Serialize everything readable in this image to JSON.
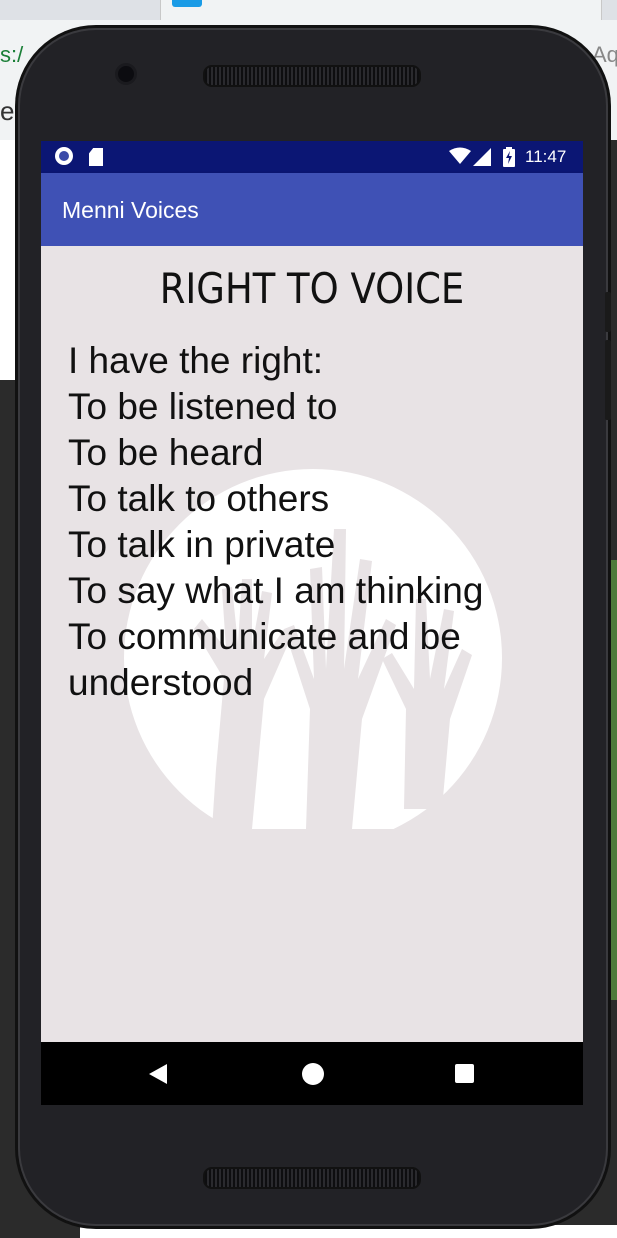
{
  "browser": {
    "url_fragment_left": "s:/",
    "url_fragment_left2": "e,",
    "url_fragment_right": "Aq"
  },
  "status_bar": {
    "time": "11:47",
    "icons": [
      "notification-circle-icon",
      "sd-card-icon",
      "wifi-icon",
      "cell-signal-icon",
      "battery-charging-icon"
    ]
  },
  "app_bar": {
    "title": "Menni Voices"
  },
  "content": {
    "heading": "RIGHT TO VOICE",
    "lines": [
      "I have the right:",
      "To be listened to",
      "To be heard",
      "To talk to others",
      "To talk in private",
      "To say what I am thinking",
      "To communicate and be",
      "understood"
    ],
    "background_icon": "raised-hands-logo"
  },
  "nav_bar": {
    "icons": [
      "back-icon",
      "home-icon",
      "recents-icon"
    ]
  },
  "colors": {
    "status_bar": "#0b1674",
    "app_bar": "#3f51b5",
    "content_bg": "#e8e3e5",
    "text": "#111111"
  }
}
